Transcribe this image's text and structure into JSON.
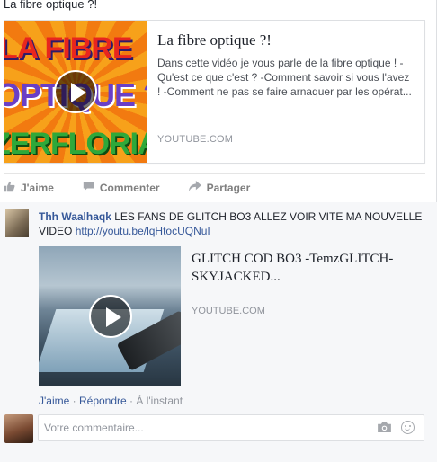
{
  "post": {
    "text": "La fibre optique ?!"
  },
  "link_preview": {
    "thumbnail_text": [
      "LA FIBRE",
      "OPTIQUE ?",
      "ZERFLORIAN"
    ],
    "title": "La fibre optique ?!",
    "description": "Dans cette vidéo je vous parle de la fibre optique ! -Qu'est ce que c'est ? -Comment savoir si vous l'avez ! -Comment ne pas se faire arnaquer par les opérat...",
    "source": "YOUTUBE.COM"
  },
  "actions": {
    "like": "J'aime",
    "comment": "Commenter",
    "share": "Partager"
  },
  "comment": {
    "author": "Thh Waalhaqk",
    "text": " LES FANS DE GLITCH BO3 ALLEZ VOIR VITE MA NOUVELLE VIDEO ",
    "link": "http://youtu.be/lqHtocUQNuI",
    "video": {
      "title": "GLITCH COD BO3 -TemzGLITCH- SKYJACKED...",
      "source": "YOUTUBE.COM"
    },
    "like": "J'aime",
    "reply": "Répondre",
    "timestamp": "À l'instant",
    "separator": " · "
  },
  "reply_box": {
    "placeholder": "Votre commentaire..."
  },
  "icons": {
    "like": "thumbs-up-icon",
    "comment": "speech-bubble-icon",
    "share": "share-arrow-icon",
    "camera": "camera-icon",
    "emoji": "smiley-icon",
    "play": "play-icon"
  },
  "colors": {
    "link_blue": "#365899",
    "muted_gray": "#90949c",
    "background": "#f6f7f9"
  }
}
